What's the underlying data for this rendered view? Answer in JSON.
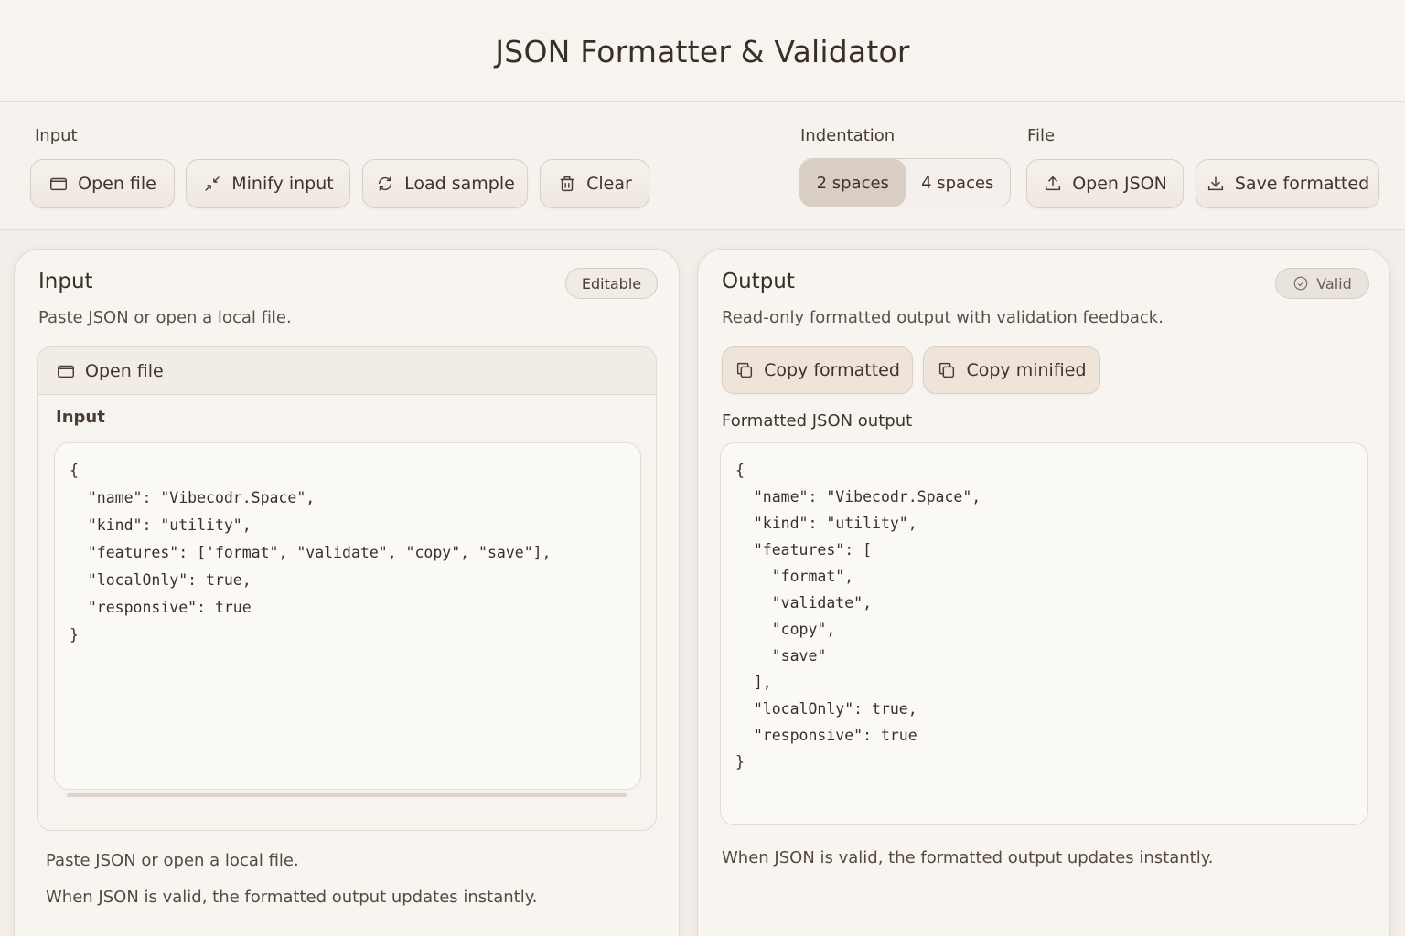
{
  "header": {
    "title": "JSON Formatter & Validator"
  },
  "toolbar": {
    "input_label": "Input",
    "open_file": "Open file",
    "minify_input": "Minify input",
    "load_sample": "Load sample",
    "clear": "Clear",
    "indentation_label": "Indentation",
    "indent_options": [
      "2 spaces",
      "4 spaces"
    ],
    "indent_selected": "2 spaces",
    "file_label": "File",
    "open_json": "Open JSON",
    "save_formatted": "Save formatted"
  },
  "input_panel": {
    "title": "Input",
    "badge": "Editable",
    "subtitle": "Paste JSON or open a local file.",
    "open_file": "Open file",
    "field_label": "Input",
    "code_lines": [
      "{",
      "  \"name\": \"Vibecodr.Space\",",
      "  \"kind\": \"utility\",",
      "  \"features\": ['format\", \"validate\", \"copy\", \"save\"],",
      "  \"localOnly\": true,",
      "  \"responsive\": true",
      "}"
    ],
    "note_1": "Paste JSON or open a local file.",
    "note_2": "When JSON is valid, the formatted output updates instantly."
  },
  "output_panel": {
    "title": "Output",
    "status": "Valid",
    "subtitle": "Read-only formatted output with validation feedback.",
    "copy_formatted": "Copy formatted",
    "copy_minified": "Copy minified",
    "field_label": "Formatted JSON output",
    "code_lines": [
      "{",
      "  \"name\": \"Vibecodr.Space\",",
      "  \"kind\": \"utility\",",
      "  \"features\": [",
      "    \"format\",",
      "    \"validate\",",
      "    \"copy\",",
      "    \"save\"",
      "  ],",
      "  \"localOnly\": true,",
      "  \"responsive\": true",
      "}"
    ],
    "note": "When JSON is valid, the formatted output updates instantly."
  }
}
